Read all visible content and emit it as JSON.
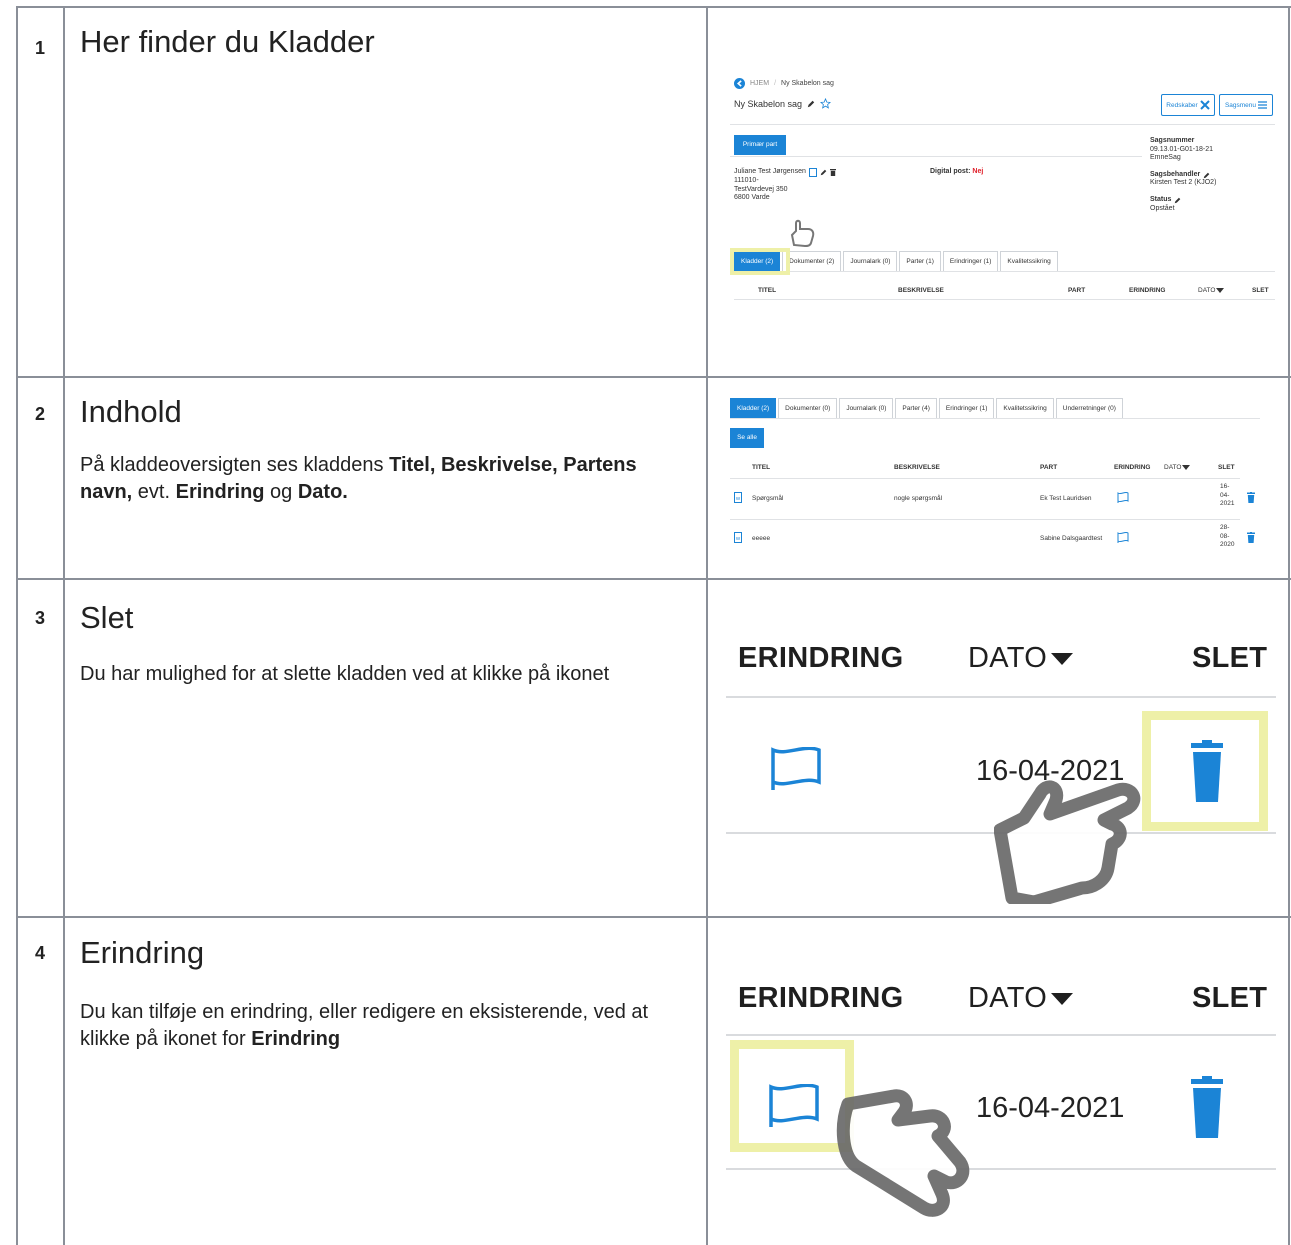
{
  "rows": [
    {
      "number": "1",
      "title": "Her finder du Kladder"
    },
    {
      "number": "2",
      "title": "Indhold",
      "desc_parts": [
        "På kladdeoversigten ses kladdens ",
        "Titel, Beskrivelse, Partens navn,",
        " evt. ",
        "Erindring",
        " og ",
        "Dato."
      ]
    },
    {
      "number": "3",
      "title": "Slet",
      "description": "Du har mulighed for at slette kladden ved at klikke på ikonet"
    },
    {
      "number": "4",
      "title": "Erindring",
      "desc_parts": [
        "Du kan tilføje en erindring, eller redigere en eksisterende, ved at klikke på ikonet for ",
        "Erindring"
      ]
    }
  ],
  "shot1": {
    "breadcrumb_home": "HJEM",
    "breadcrumb_sep": "/",
    "breadcrumb_current": "Ny Skabelon sag",
    "case_title": "Ny Skabelon sag",
    "tools_button": "Redskaber",
    "menu_button": "Sagsmenu",
    "primary_party_button": "Primær part",
    "party_name": "Juliane Test Jørgensen",
    "party_id": "111010-",
    "party_address": "TestVardevej 350",
    "party_city": "6800 Varde",
    "digital_post_label": "Digital post:",
    "digital_post_value": "Nej",
    "case_number_label": "Sagsnummer",
    "case_number_value": "09.13.01-G01-18-21",
    "case_type": "EmneSag",
    "handler_label": "Sagsbehandler",
    "handler_value": "Kirsten Test 2 (KJO2)",
    "status_label": "Status",
    "status_value": "Opstået",
    "tabs": [
      "Kladder (2)",
      "Dokumenter (2)",
      "Journalark (0)",
      "Parter (1)",
      "Erindringer (1)",
      "Kvalitetssikring"
    ],
    "columns": [
      "TITEL",
      "BESKRIVELSE",
      "PART",
      "ERINDRING",
      "DATO",
      "SLET"
    ]
  },
  "shot2": {
    "tabs": [
      "Kladder (2)",
      "Dokumenter (0)",
      "Journalark (0)",
      "Parter (4)",
      "Erindringer (1)",
      "Kvalitetssikring",
      "Underretninger (0)"
    ],
    "see_all_button": "Se alle",
    "columns": [
      "TITEL",
      "BESKRIVELSE",
      "PART",
      "ERINDRING",
      "DATO",
      "SLET"
    ],
    "table_rows": [
      {
        "title": "Spørgsmål",
        "description": "nogle spørgsmål",
        "party": "Ek Test Lauridsen",
        "date_parts": [
          "16-",
          "04-",
          "2021"
        ]
      },
      {
        "title": "eeeee",
        "description": "",
        "party": "Sabine Dalsgaardtest",
        "date_parts": [
          "28-",
          "08-",
          "2020"
        ]
      }
    ]
  },
  "zoom": {
    "col_reminder": "ERINDRING",
    "col_date": "DATO",
    "col_delete": "SLET",
    "date_value": "16-04-2021"
  },
  "icons": {
    "back": "arrow-left-circle-icon",
    "edit": "pencil-icon",
    "star": "star-outline-icon",
    "tools": "tools-icon",
    "menu": "hamburger-icon",
    "delete": "trash-icon",
    "reminder": "flag-outline-icon",
    "document": "word-document-icon",
    "pointer": "hand-pointer-icon",
    "sort": "caret-down-icon"
  },
  "colors": {
    "accent": "#1b84d6",
    "highlight": "#eef0a8",
    "alert": "#e0202a",
    "grid": "#8a8f98"
  }
}
